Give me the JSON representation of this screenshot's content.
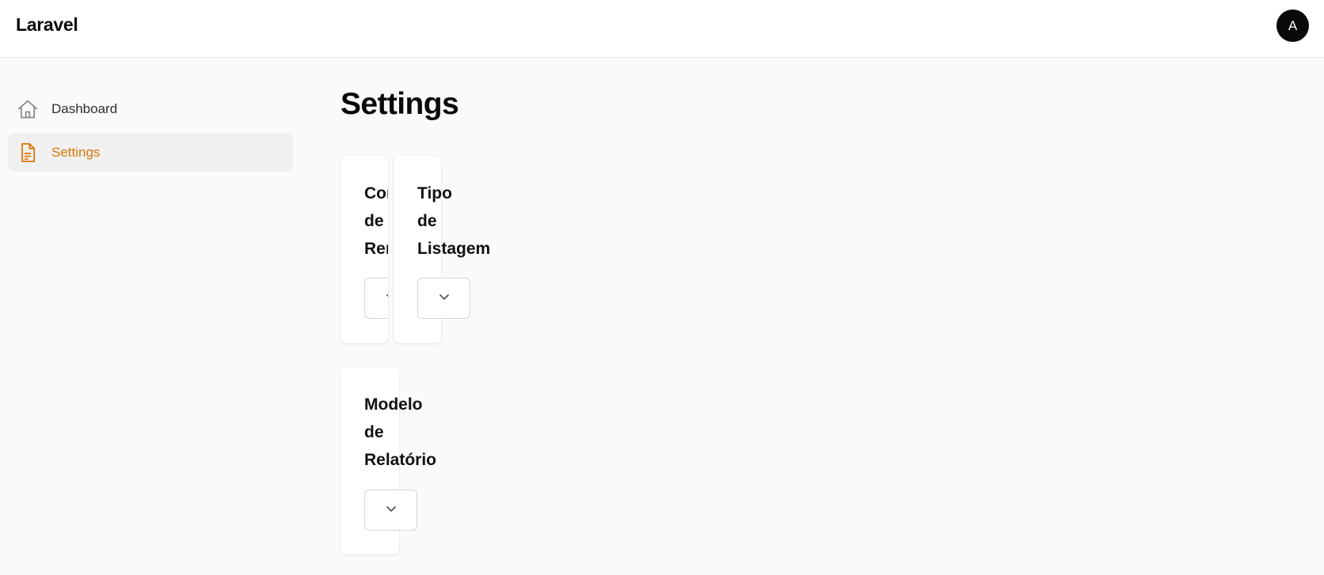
{
  "header": {
    "brand": "Laravel",
    "avatar_initial": "A"
  },
  "sidebar": {
    "items": [
      {
        "label": "Dashboard",
        "icon": "home-icon",
        "active": false
      },
      {
        "label": "Settings",
        "icon": "document-icon",
        "active": true
      }
    ]
  },
  "main": {
    "title": "Settings",
    "cards": [
      {
        "label": "Con\nde\nRem",
        "select_value": ""
      },
      {
        "label": "Tipo\nde\nListagem",
        "select_value": ""
      },
      {
        "label": "Modelo\nde\nRelatório",
        "select_value": ""
      }
    ]
  },
  "colors": {
    "accent": "#d97706",
    "active_bg": "#f0f0f0",
    "page_bg": "#fafafa"
  }
}
